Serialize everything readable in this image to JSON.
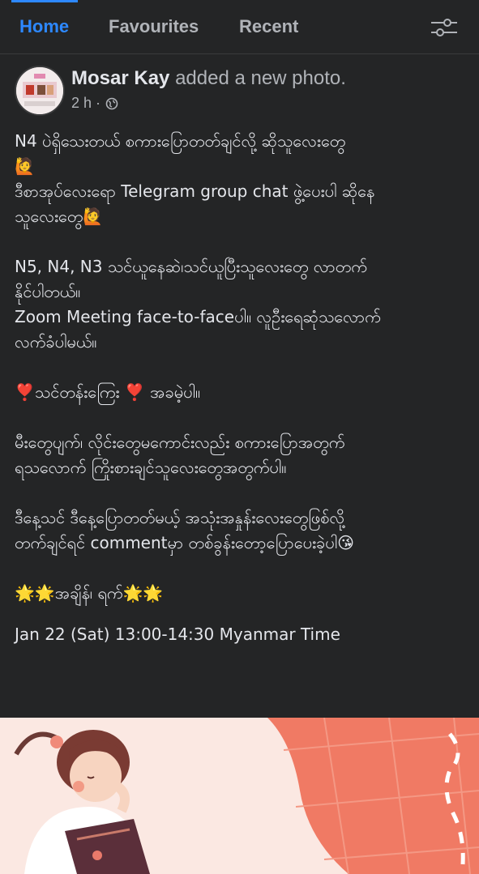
{
  "tabs": {
    "home": "Home",
    "favourites": "Favourites",
    "recent": "Recent"
  },
  "post": {
    "author": "Mosar Kay",
    "action": "added a new photo.",
    "time": "2 h ·",
    "lines": {
      "p1_l1": "N4 ပဲရှိသေးတယ် စကားပြောတတ်ချင်လို့ ဆိုသူလေးတွေ",
      "p1_l2": "🙋",
      "p1_l3": "ဒီစာအုပ်လေးရော Telegram group chat ဖွဲ့ပေးပါ ဆိုနေ",
      "p1_l4": "သူလေးတွေ🙋",
      "p2_l1": "N5, N4, N3 သင်ယူနေဆဲ၊သင်ယူပြီးသူလေးတွေ လာတက်",
      "p2_l2": "နိုင်ပါတယ်။",
      "p2_l3": "Zoom Meeting face-to-faceပါ။ လူဦးရေဆုံသလောက်",
      "p2_l4": "လက်ခံပါမယ်။",
      "p3_l1": "❣️သင်တန်းကြေး ❣️ အခမဲ့ပါ။",
      "p4_l1": "မီးတွေပျက်၊ လိုင်းတွေမကောင်းလည်း စကားပြောအတွက်",
      "p4_l2": "ရသလောက် ကြိုးစားချင်သူလေးတွေအတွက်ပါ။",
      "p5_l1": "ဒီနေ့သင် ဒီနေ့ပြောတတ်မယ့် အသုံးအနှုန်းလေးတွေဖြစ်လို့",
      "p5_l2": "တက်ချင်ရင် commentမှာ တစ်ခွန်းတော့ပြောပေးခဲ့ပါ😘",
      "p6_l1": "🌟🌟အချိန်၊ ရက်🌟🌟",
      "p6_l2": "Jan 22 (Sat) 13:00-14:30 Myanmar Time"
    }
  },
  "colors": {
    "background": "#18191a",
    "surface": "#242526",
    "accent": "#2d88ff",
    "text": "#e4e6eb",
    "secondary_text": "#b0b3b8",
    "image_background": "#fbe8e2",
    "image_tile": "#f07a64"
  },
  "icons": {
    "filter": "filter-sliders-icon",
    "privacy": "globe-icon"
  }
}
